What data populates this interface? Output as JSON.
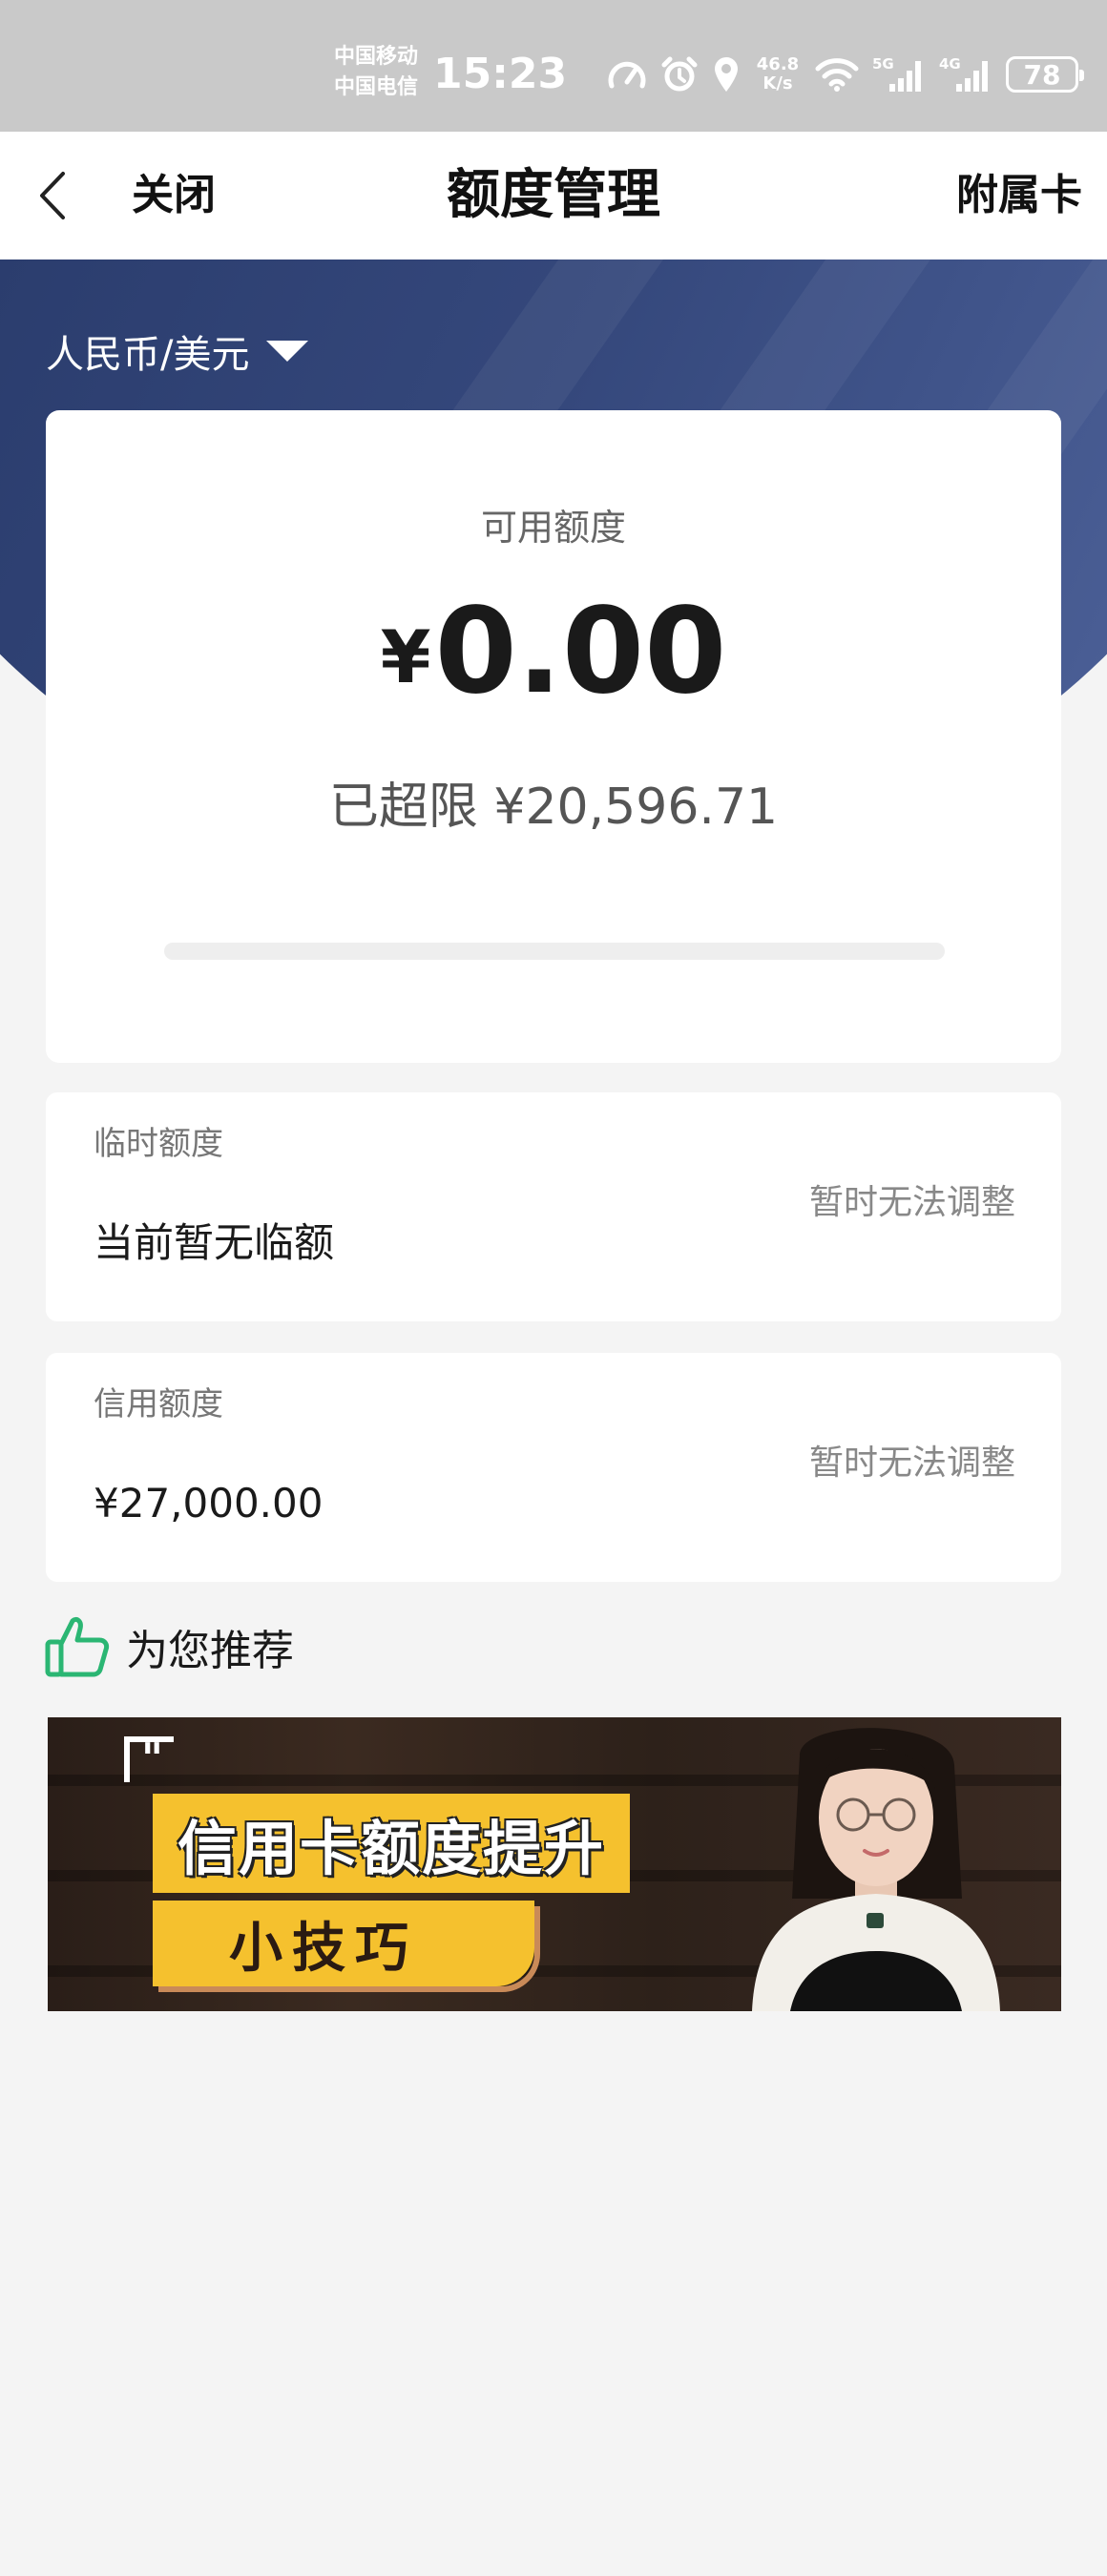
{
  "status_bar": {
    "carrier_1": "中国移动",
    "carrier_2": "中国电信",
    "time": "15:23",
    "net_speed_value": "46.8",
    "net_speed_unit": "K/s",
    "signal_1_label": "5G",
    "signal_2_label": "4G",
    "battery": "78"
  },
  "nav": {
    "close_label": "关闭",
    "title": "额度管理",
    "secondary_card_label": "附属卡"
  },
  "currency": {
    "selected": "人民币/美元"
  },
  "available": {
    "label": "可用额度",
    "currency_symbol": "¥",
    "amount": "0.00",
    "overlimit_text": "已超限 ¥20,596.71",
    "usage_fraction": 0
  },
  "temporary_limit": {
    "label": "临时额度",
    "value": "当前暂无临额",
    "action": "暂时无法调整"
  },
  "credit_limit": {
    "label": "信用额度",
    "value": "¥27,000.00",
    "action": "暂时无法调整"
  },
  "recommend": {
    "title": "为您推荐",
    "banner_title": "信用卡额度提升",
    "banner_subtitle": "小技巧"
  },
  "colors": {
    "hero_blue": "#35487c",
    "recommend_icon_green": "#2bb673",
    "banner_yellow": "#f5c12e"
  },
  "icons": {
    "back": "chevron-left-icon",
    "currency_dropdown": "caret-down-icon",
    "recommend": "thumbs-up-icon"
  }
}
